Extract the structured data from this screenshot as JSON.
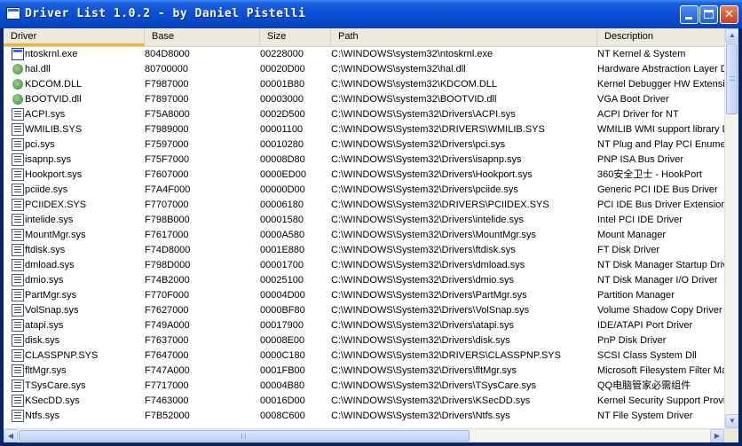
{
  "window": {
    "title": "Driver List 1.0.2 - by Daniel Pistelli"
  },
  "columns": [
    "Driver",
    "Base",
    "Size",
    "Path",
    "Description"
  ],
  "rows": [
    {
      "icon": "exe",
      "name": "ntoskrnl.exe",
      "base": "804D8000",
      "size": "00228000",
      "path": "C:\\WINDOWS\\system32\\ntoskrnl.exe",
      "desc": "NT Kernel & System"
    },
    {
      "icon": "dll",
      "name": "hal.dll",
      "base": "80700000",
      "size": "00020D00",
      "path": "C:\\WINDOWS\\system32\\hal.dll",
      "desc": "Hardware Abstraction Layer DLL"
    },
    {
      "icon": "dll",
      "name": "KDCOM.DLL",
      "base": "F7987000",
      "size": "00001B80",
      "path": "C:\\WINDOWS\\system32\\KDCOM.DLL",
      "desc": "Kernel Debugger HW Extension"
    },
    {
      "icon": "dll",
      "name": "BOOTVID.dll",
      "base": "F7897000",
      "size": "00003000",
      "path": "C:\\WINDOWS\\system32\\BOOTVID.dll",
      "desc": "VGA Boot Driver"
    },
    {
      "icon": "sys",
      "name": "ACPI.sys",
      "base": "F75A8000",
      "size": "0002D500",
      "path": "C:\\WINDOWS\\System32\\Drivers\\ACPI.sys",
      "desc": "ACPI Driver for NT"
    },
    {
      "icon": "sys",
      "name": "WMILIB.SYS",
      "base": "F7989000",
      "size": "00001100",
      "path": "C:\\WINDOWS\\System32\\DRIVERS\\WMILIB.SYS",
      "desc": "WMILIB WMI support library DLL"
    },
    {
      "icon": "sys",
      "name": "pci.sys",
      "base": "F7597000",
      "size": "00010280",
      "path": "C:\\WINDOWS\\System32\\Drivers\\pci.sys",
      "desc": "NT Plug and Play PCI Enumerator"
    },
    {
      "icon": "sys",
      "name": "isapnp.sys",
      "base": "F75F7000",
      "size": "00008D80",
      "path": "C:\\WINDOWS\\System32\\Drivers\\isapnp.sys",
      "desc": "PNP ISA Bus Driver"
    },
    {
      "icon": "sys",
      "name": "Hookport.sys",
      "base": "F7607000",
      "size": "0000ED00",
      "path": "C:\\WINDOWS\\System32\\Drivers\\Hookport.sys",
      "desc": "360安全卫士 - HookPort"
    },
    {
      "icon": "sys",
      "name": "pciide.sys",
      "base": "F7A4F000",
      "size": "00000D00",
      "path": "C:\\WINDOWS\\System32\\Drivers\\pciide.sys",
      "desc": "Generic PCI IDE Bus Driver"
    },
    {
      "icon": "sys",
      "name": "PCIIDEX.SYS",
      "base": "F7707000",
      "size": "00006180",
      "path": "C:\\WINDOWS\\System32\\DRIVERS\\PCIIDEX.SYS",
      "desc": "PCI IDE Bus Driver Extension"
    },
    {
      "icon": "sys",
      "name": "intelide.sys",
      "base": "F798B000",
      "size": "00001580",
      "path": "C:\\WINDOWS\\System32\\Drivers\\intelide.sys",
      "desc": "Intel PCI IDE Driver"
    },
    {
      "icon": "sys",
      "name": "MountMgr.sys",
      "base": "F7617000",
      "size": "0000A580",
      "path": "C:\\WINDOWS\\System32\\Drivers\\MountMgr.sys",
      "desc": "Mount Manager"
    },
    {
      "icon": "sys",
      "name": "ftdisk.sys",
      "base": "F74D8000",
      "size": "0001E880",
      "path": "C:\\WINDOWS\\System32\\Drivers\\ftdisk.sys",
      "desc": "FT Disk Driver"
    },
    {
      "icon": "sys",
      "name": "dmload.sys",
      "base": "F798D000",
      "size": "00001700",
      "path": "C:\\WINDOWS\\System32\\Drivers\\dmload.sys",
      "desc": "NT Disk Manager Startup Driver"
    },
    {
      "icon": "sys",
      "name": "dmio.sys",
      "base": "F74B2000",
      "size": "00025100",
      "path": "C:\\WINDOWS\\System32\\Drivers\\dmio.sys",
      "desc": "NT Disk Manager I/O Driver"
    },
    {
      "icon": "sys",
      "name": "PartMgr.sys",
      "base": "F770F000",
      "size": "00004D00",
      "path": "C:\\WINDOWS\\System32\\Drivers\\PartMgr.sys",
      "desc": "Partition Manager"
    },
    {
      "icon": "sys",
      "name": "VolSnap.sys",
      "base": "F7627000",
      "size": "0000BF80",
      "path": "C:\\WINDOWS\\System32\\Drivers\\VolSnap.sys",
      "desc": "Volume Shadow Copy Driver"
    },
    {
      "icon": "sys",
      "name": "atapi.sys",
      "base": "F749A000",
      "size": "00017900",
      "path": "C:\\WINDOWS\\System32\\Drivers\\atapi.sys",
      "desc": "IDE/ATAPI Port Driver"
    },
    {
      "icon": "sys",
      "name": "disk.sys",
      "base": "F7637000",
      "size": "00008E00",
      "path": "C:\\WINDOWS\\System32\\Drivers\\disk.sys",
      "desc": "PnP Disk Driver"
    },
    {
      "icon": "sys",
      "name": "CLASSPNP.SYS",
      "base": "F7647000",
      "size": "0000C180",
      "path": "C:\\WINDOWS\\System32\\DRIVERS\\CLASSPNP.SYS",
      "desc": "SCSI Class System Dll"
    },
    {
      "icon": "sys",
      "name": "fltMgr.sys",
      "base": "F747A000",
      "size": "0001FB00",
      "path": "C:\\WINDOWS\\System32\\Drivers\\fltMgr.sys",
      "desc": "Microsoft Filesystem Filter Manager"
    },
    {
      "icon": "sys",
      "name": "TSysCare.sys",
      "base": "F7717000",
      "size": "00004B80",
      "path": "C:\\WINDOWS\\System32\\Drivers\\TSysCare.sys",
      "desc": "QQ电脑管家必需组件"
    },
    {
      "icon": "sys",
      "name": "KSecDD.sys",
      "base": "F7463000",
      "size": "00016D00",
      "path": "C:\\WINDOWS\\System32\\Drivers\\KSecDD.sys",
      "desc": "Kernel Security Support Provider"
    },
    {
      "icon": "sys",
      "name": "Ntfs.sys",
      "base": "F7B52000",
      "size": "0008C600",
      "path": "C:\\WINDOWS\\System32\\Drivers\\Ntfs.sys",
      "desc": "NT File System Driver"
    }
  ]
}
